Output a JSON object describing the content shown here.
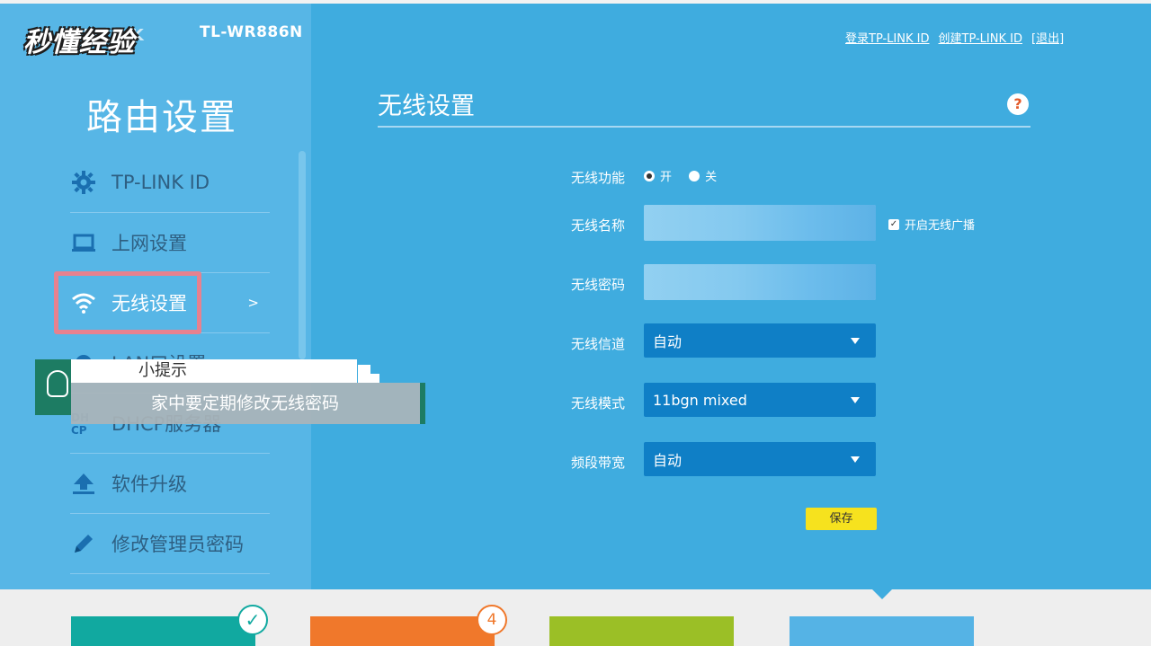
{
  "watermark": "秒懂经验",
  "header": {
    "model": "TL-WR886N",
    "links": [
      "登录TP-LINK ID",
      "创建TP-LINK ID",
      "[退出]"
    ]
  },
  "sidebar": {
    "title": "路由设置",
    "items": [
      {
        "label": "TP-LINK ID",
        "icon": "gear-icon"
      },
      {
        "label": "上网设置",
        "icon": "laptop-icon"
      },
      {
        "label": "无线设置",
        "icon": "wifi-icon",
        "active": true,
        "chevron": ">"
      },
      {
        "label": "LAN口设置",
        "icon": "gear-icon"
      },
      {
        "label": "DHCP服务器",
        "icon": "dhcp-icon"
      },
      {
        "label": "软件升级",
        "icon": "upload-icon"
      },
      {
        "label": "修改管理员密码",
        "icon": "pencil-icon"
      }
    ]
  },
  "main": {
    "title": "无线设置",
    "help": "?",
    "wireless_function": {
      "label": "无线功能",
      "on": "开",
      "off": "关",
      "value": "on"
    },
    "ssid": {
      "label": "无线名称",
      "broadcast_label": "开启无线广播",
      "broadcast_checked": true
    },
    "password": {
      "label": "无线密码"
    },
    "channel": {
      "label": "无线信道",
      "value": "自动"
    },
    "mode": {
      "label": "无线模式",
      "value": "11bgn mixed"
    },
    "bandwidth": {
      "label": "频段带宽",
      "value": "自动"
    },
    "save_label": "保存"
  },
  "tip": {
    "title": "小提示",
    "body": "家中要定期修改无线密码"
  },
  "bottom": {
    "badge_count": "4",
    "colors": [
      "#11a9a0",
      "#f0782b",
      "#9bbf26",
      "#55b3e5"
    ]
  }
}
